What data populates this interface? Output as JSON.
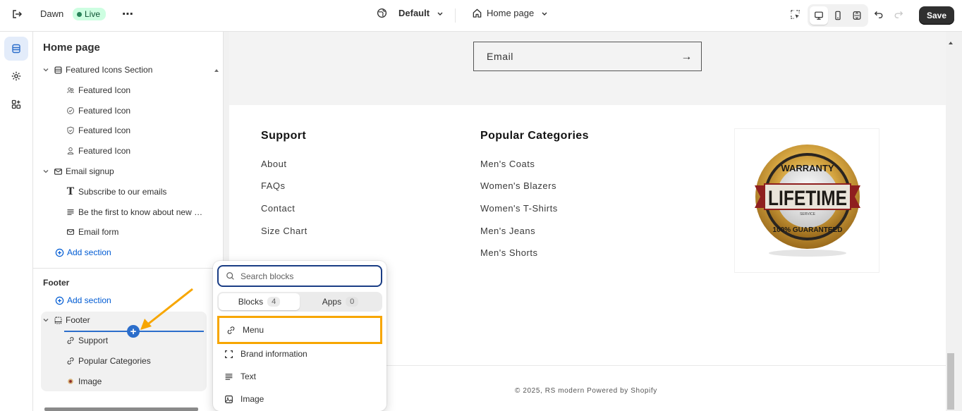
{
  "topbar": {
    "theme_name": "Dawn",
    "live_label": "Live",
    "template_label": "Default",
    "page_label": "Home page",
    "save_label": "Save"
  },
  "sidebar": {
    "title": "Home page",
    "featured_section": "Featured Icons Section",
    "featured_children": [
      "Featured Icon",
      "Featured Icon",
      "Featured Icon",
      "Featured Icon"
    ],
    "email_section": "Email signup",
    "email_children": [
      "Subscribe to our emails",
      "Be the first to know about new c...",
      "Email form"
    ],
    "add_section_label": "Add section",
    "footer_group_title": "Footer",
    "footer_add_section_label": "Add section",
    "footer_section": "Footer",
    "footer_children": [
      "Support",
      "Popular Categories",
      "Image"
    ]
  },
  "preview": {
    "email_placeholder": "Email",
    "support_heading": "Support",
    "support_links": [
      "About",
      "FAQs",
      "Contact",
      "Size Chart"
    ],
    "categories_heading": "Popular Categories",
    "categories_links": [
      "Men's Coats",
      "Women's Blazers",
      "Women's T-Shirts",
      "Men's Jeans",
      "Men's Shorts"
    ],
    "badge": {
      "top": "WARRANTY",
      "center": "LIFETIME",
      "small": "SERVICE",
      "bottom": "100% GUARANTEED"
    },
    "copyright": "© 2025, RS modern Powered by Shopify"
  },
  "popup": {
    "search_placeholder": "Search blocks",
    "tabs": [
      {
        "label": "Blocks",
        "count": "4"
      },
      {
        "label": "Apps",
        "count": "0"
      }
    ],
    "items": [
      "Menu",
      "Brand information",
      "Text",
      "Image"
    ]
  },
  "colors": {
    "accent_blue": "#2c6ecb",
    "highlight_orange": "#f7a600",
    "live_green": "#29845a"
  }
}
